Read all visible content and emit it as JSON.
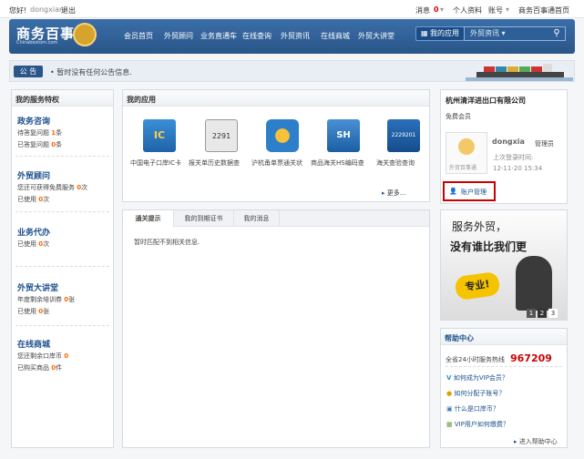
{
  "topbar": {
    "greeting": "您好!",
    "username": "dongxian",
    "logout": "退出",
    "messages": "消息",
    "message_count": "0",
    "personal_info": "个人资料",
    "account": "账号",
    "homepage": "商务百事通首页"
  },
  "brand": {
    "name": "商务百事",
    "domain": "Chinabestom.com"
  },
  "nav": [
    "会员首页",
    "外贸顾问",
    "业务直通车",
    "在线查询",
    "外贸资讯",
    "在线商城",
    "外贸大讲堂"
  ],
  "myapp_button": "我的应用",
  "search": {
    "category": "外贸资讯"
  },
  "notice": {
    "label": "公 告",
    "text": "• 暂时没有任何公告信息."
  },
  "services": {
    "title": "我的服务特权",
    "items": [
      {
        "title": "政务咨询",
        "lines": [
          {
            "pre": "待答复问题 ",
            "num": "1",
            "post": "条"
          },
          {
            "pre": "已答复问题 ",
            "num": "0",
            "post": "条"
          }
        ]
      },
      {
        "title": "外贸顾问",
        "lines": [
          {
            "pre": "您还可获得免费服务 ",
            "num": "0",
            "post": "次"
          },
          {
            "pre": "已使用 ",
            "num": "0",
            "post": "次"
          }
        ]
      },
      {
        "title": "业务代办",
        "lines": [
          {
            "pre": "已使用 ",
            "num": "0",
            "post": "次"
          }
        ]
      },
      {
        "title": "外贸大讲堂",
        "lines": [
          {
            "pre": "年度剩余培训券 ",
            "num": "0",
            "post": "张"
          },
          {
            "pre": "已使用 ",
            "num": "0",
            "post": "张"
          }
        ]
      },
      {
        "title": "在线商城",
        "lines": [
          {
            "pre": "您还剩余口岸币 ",
            "num": "0",
            "post": ""
          },
          {
            "pre": "已购买商品 ",
            "num": "0",
            "post": "件"
          }
        ]
      }
    ]
  },
  "apps": {
    "title": "我的应用",
    "items": [
      {
        "label": "中国电子口岸IC卡",
        "icon_text": "IC"
      },
      {
        "label": "报关单历史数据查",
        "icon_text": "2291"
      },
      {
        "label": "沪杭甬单票通关状",
        "icon_text": ""
      },
      {
        "label": "商品海关HS编码查",
        "icon_text": "SH"
      },
      {
        "label": "海关查验查询",
        "icon_text": "2229201"
      }
    ],
    "more": "更多..."
  },
  "tabs": {
    "items": [
      "通关提示",
      "我的到期证书",
      "我的消息"
    ],
    "content": "暂时匹配不到相关信息."
  },
  "account": {
    "company": "杭州清洋进出口有限公司",
    "level": "免费会员",
    "avatar_caption": "外贸百事通",
    "username": "dongxia",
    "role": "管理员",
    "last_login_label": "上次登录时间:",
    "last_login": "12-11-20 15:34",
    "manage_button": "账户管理"
  },
  "ad": {
    "line1": "服务外贸，",
    "line2": "没有谁比我们更",
    "badge": "专业!",
    "pages": [
      "1",
      "2",
      "3"
    ]
  },
  "help": {
    "title": "帮助中心",
    "hotline_label": "全省24小时服务热线",
    "hotline": "967209",
    "items": [
      "如何成为VIP会员？",
      "如何分配子账号？",
      "什么是口岸币？",
      "VIP用户如何缴费？"
    ],
    "link": "进入帮助中心"
  },
  "colors": {
    "accent": "#2a5689",
    "highlight": "#ff6600",
    "alert": "#cc0000"
  }
}
